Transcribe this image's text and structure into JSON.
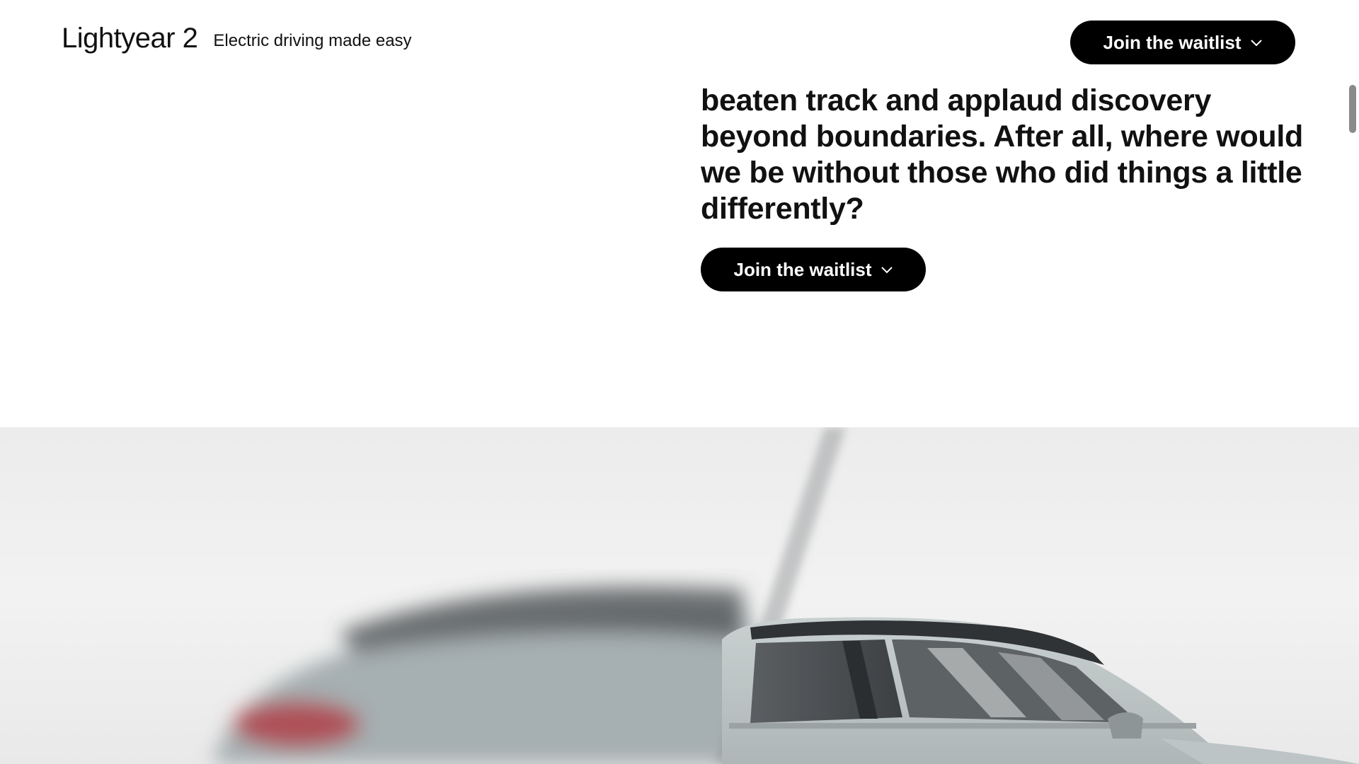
{
  "header": {
    "brand_name": "Lightyear 2",
    "tagline": "Electric driving made easy",
    "cta_label": "Join the waitlist"
  },
  "main": {
    "paragraph": "beaten track and applaud discovery beyond boundaries. After all, where would we be without those who did things a little differently?",
    "cta_label": "Join the waitlist"
  },
  "hero": {
    "image_subject": "Lightyear 2 electric car"
  },
  "colors": {
    "button_bg": "#000000",
    "button_text": "#ffffff",
    "text": "#111111",
    "hero_bg": "#ececec"
  },
  "icons": {
    "cta_chevron": "chevron-down-icon"
  }
}
